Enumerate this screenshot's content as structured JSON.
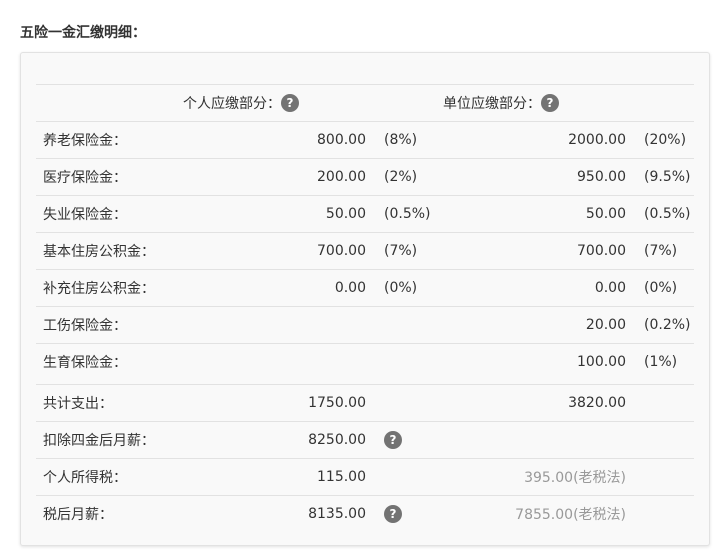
{
  "title": "五险一金汇缴明细：",
  "header": {
    "personal": "个人应缴部分：",
    "company": "单位应缴部分："
  },
  "icons": {
    "help": "question-circle-icon",
    "glyph": "?"
  },
  "rows": [
    {
      "label": "养老保险金：",
      "personal": "800.00",
      "personal_pct": "(8%)",
      "company": "2000.00",
      "company_pct": "(20%)"
    },
    {
      "label": "医疗保险金：",
      "personal": "200.00",
      "personal_pct": "(2%)",
      "company": "950.00",
      "company_pct": "(9.5%)"
    },
    {
      "label": "失业保险金：",
      "personal": "50.00",
      "personal_pct": "(0.5%)",
      "company": "50.00",
      "company_pct": "(0.5%)"
    },
    {
      "label": "基本住房公积金：",
      "personal": "700.00",
      "personal_pct": "(7%)",
      "company": "700.00",
      "company_pct": "(7%)"
    },
    {
      "label": "补充住房公积金：",
      "personal": "0.00",
      "personal_pct": "(0%)",
      "company": "0.00",
      "company_pct": "(0%)"
    },
    {
      "label": "工伤保险金：",
      "personal": "",
      "personal_pct": "",
      "company": "20.00",
      "company_pct": "(0.2%)"
    },
    {
      "label": "生育保险金：",
      "personal": "",
      "personal_pct": "",
      "company": "100.00",
      "company_pct": "(1%)"
    }
  ],
  "summary": {
    "total": {
      "label": "共计支出：",
      "personal": "1750.00",
      "company": "3820.00"
    },
    "after_deduct": {
      "label": "扣除四金后月薪：",
      "personal": "8250.00"
    },
    "tax": {
      "label": "个人所得税：",
      "personal": "115.00",
      "company": "395.00(老税法)"
    },
    "net": {
      "label": "税后月薪：",
      "personal": "8135.00",
      "company": "7855.00(老税法)"
    }
  }
}
